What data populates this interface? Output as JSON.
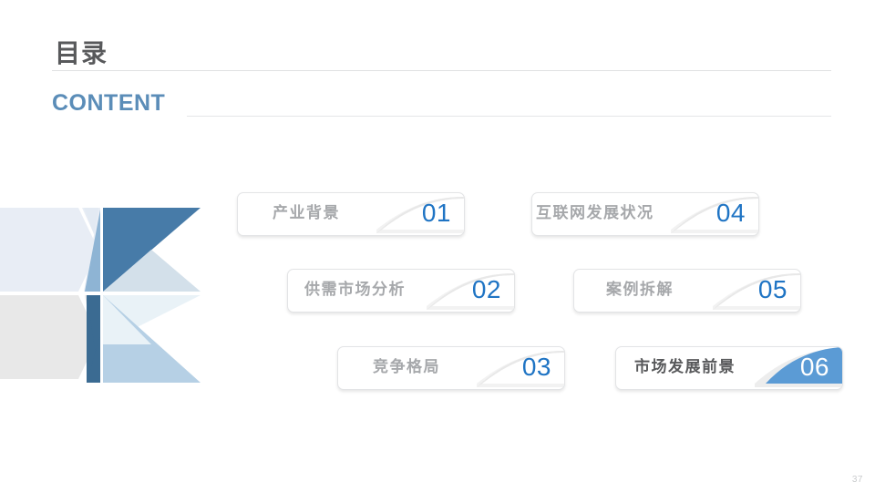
{
  "slide": {
    "title_cn": "目录",
    "title_en": "CONTENT",
    "page_number": "37"
  },
  "colors": {
    "accent_blue": "#5b8db8",
    "number_blue": "#1f74c4",
    "active_fill": "#5b9bd5",
    "title_gray": "#58595b",
    "label_gray": "#a6a8ab",
    "divider": "#e0e1e3",
    "decor_dark_blue": "#477ba8",
    "decor_deep_blue": "#3b6b92",
    "decor_mid_blue": "#8eb4d4",
    "decor_light_blue": "#b6d0e5",
    "decor_pale_blue": "#d3e0ea",
    "decor_faint_blue": "#e9f2f7",
    "decor_panel_blue": "#e8edf5",
    "decor_panel_gray": "#e8e8e8"
  },
  "decor": {
    "name": "geometric-triangles-graphic"
  },
  "items": [
    {
      "id": "box-1",
      "label": "产业背景",
      "number": "01",
      "active": false
    },
    {
      "id": "box-2",
      "label": "供需市场分析",
      "number": "02",
      "active": false
    },
    {
      "id": "box-3",
      "label": "竞争格局",
      "number": "03",
      "active": false
    },
    {
      "id": "box-4",
      "label": "互联网发展状况",
      "number": "04",
      "active": false
    },
    {
      "id": "box-5",
      "label": "案例拆解",
      "number": "05",
      "active": false
    },
    {
      "id": "box-6",
      "label": "市场发展前景",
      "number": "06",
      "active": true
    }
  ]
}
